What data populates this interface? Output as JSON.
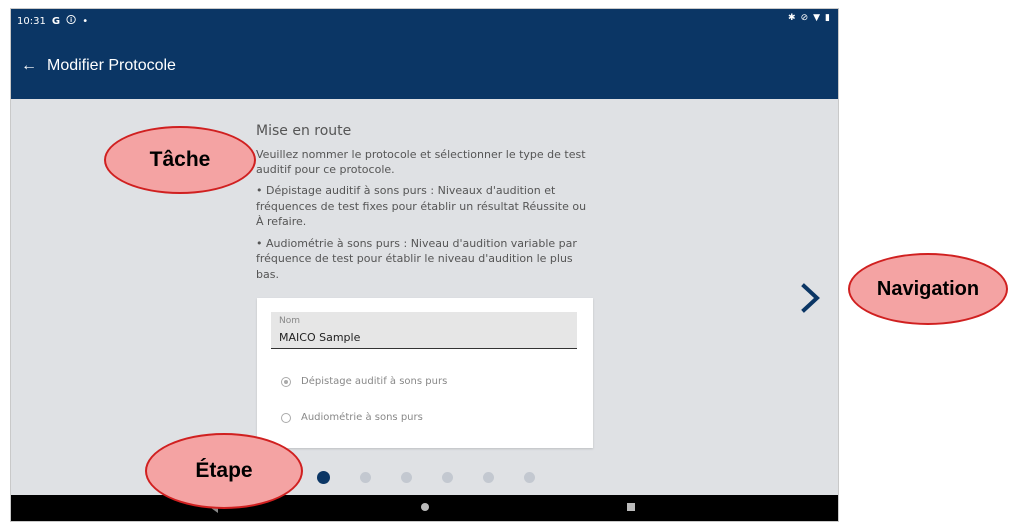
{
  "status_bar": {
    "time": "10:31",
    "left_icons": [
      "G",
      "alert-icon",
      "dot-icon"
    ],
    "right_icons": [
      "bluetooth-icon",
      "mute-icon",
      "wifi-icon",
      "battery-icon"
    ]
  },
  "app_bar": {
    "title": "Modifier Protocole",
    "back_icon": "←"
  },
  "content": {
    "heading": "Mise en route",
    "intro": "Veuillez nommer le protocole et sélectionner le type de test auditif pour ce protocole.",
    "bullets": [
      "• Dépistage auditif à sons purs : Niveaux d'audition et fréquences de test fixes pour établir un résultat Réussite ou À refaire.",
      "• Audiométrie à sons purs : Niveau d'audition variable par fréquence de test pour établir le niveau d'audition le plus bas."
    ]
  },
  "form": {
    "name_label": "Nom",
    "name_value": "MAICO Sample",
    "options": [
      {
        "label": "Dépistage auditif à sons purs",
        "selected": true
      },
      {
        "label": "Audiométrie à sons purs",
        "selected": false
      }
    ]
  },
  "pager": {
    "total_steps": 6,
    "current_step": 1
  },
  "callouts": {
    "tache": "Tâche",
    "navigation": "Navigation",
    "etape": "Étape"
  },
  "colors": {
    "primary": "#0b3665",
    "background": "#dfe1e4",
    "callout_fill": "#f4a3a3",
    "callout_border": "#d02020"
  }
}
